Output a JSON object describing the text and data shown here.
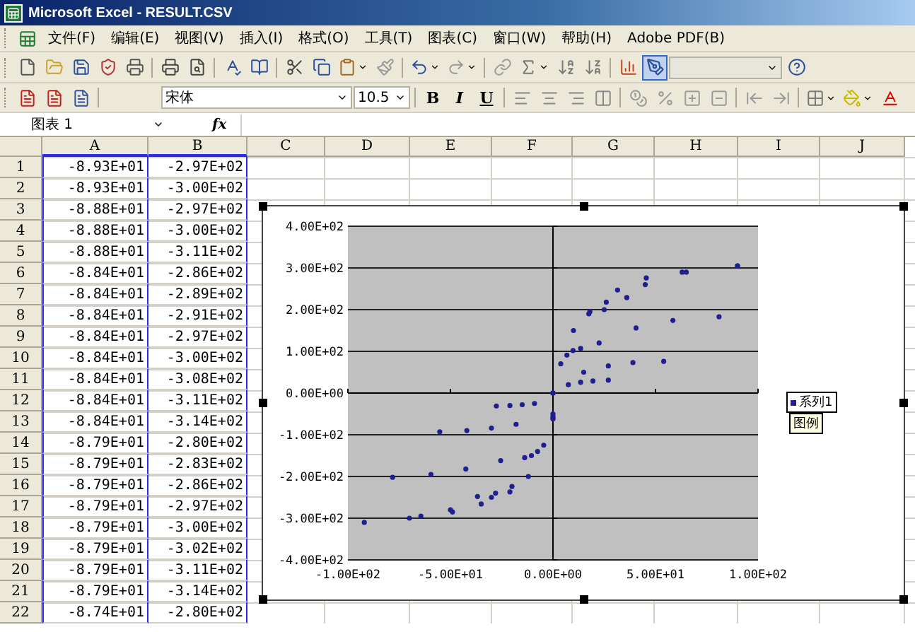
{
  "window": {
    "title": "Microsoft Excel - RESULT.CSV"
  },
  "menu": [
    {
      "label": "文件(F)"
    },
    {
      "label": "编辑(E)"
    },
    {
      "label": "视图(V)"
    },
    {
      "label": "插入(I)"
    },
    {
      "label": "格式(O)"
    },
    {
      "label": "工具(T)"
    },
    {
      "label": "图表(C)"
    },
    {
      "label": "窗口(W)"
    },
    {
      "label": "帮助(H)"
    },
    {
      "label": "Adobe PDF(B)"
    }
  ],
  "toolbar_standard": {
    "drawing_pressed": true
  },
  "toolbar_formatting": {
    "font": "宋体",
    "size": "10.5",
    "style_buttons": [
      "B",
      "I",
      "U"
    ]
  },
  "formula_bar": {
    "name_box": "图表 1",
    "fx": "fx"
  },
  "sheet": {
    "columns": [
      {
        "label": "A",
        "in_data_range": true
      },
      {
        "label": "B",
        "in_data_range": true
      },
      {
        "label": "C",
        "in_data_range": false
      },
      {
        "label": "D",
        "in_data_range": false
      },
      {
        "label": "E",
        "in_data_range": false
      },
      {
        "label": "F",
        "in_data_range": false
      },
      {
        "label": "G",
        "in_data_range": false
      },
      {
        "label": "H",
        "in_data_range": false
      },
      {
        "label": "I",
        "in_data_range": false
      },
      {
        "label": "J",
        "in_data_range": false
      }
    ],
    "rows": [
      {
        "number": "1",
        "cells": [
          "-8.93E+01",
          "-2.97E+02"
        ]
      },
      {
        "number": "2",
        "cells": [
          "-8.93E+01",
          "-3.00E+02"
        ]
      },
      {
        "number": "3",
        "cells": [
          "-8.88E+01",
          "-2.97E+02"
        ]
      },
      {
        "number": "4",
        "cells": [
          "-8.88E+01",
          "-3.00E+02"
        ]
      },
      {
        "number": "5",
        "cells": [
          "-8.88E+01",
          "-3.11E+02"
        ]
      },
      {
        "number": "6",
        "cells": [
          "-8.84E+01",
          "-2.86E+02"
        ]
      },
      {
        "number": "7",
        "cells": [
          "-8.84E+01",
          "-2.89E+02"
        ]
      },
      {
        "number": "8",
        "cells": [
          "-8.84E+01",
          "-2.91E+02"
        ]
      },
      {
        "number": "9",
        "cells": [
          "-8.84E+01",
          "-2.97E+02"
        ]
      },
      {
        "number": "10",
        "cells": [
          "-8.84E+01",
          "-3.00E+02"
        ]
      },
      {
        "number": "11",
        "cells": [
          "-8.84E+01",
          "-3.08E+02"
        ]
      },
      {
        "number": "12",
        "cells": [
          "-8.84E+01",
          "-3.11E+02"
        ]
      },
      {
        "number": "13",
        "cells": [
          "-8.84E+01",
          "-3.14E+02"
        ]
      },
      {
        "number": "14",
        "cells": [
          "-8.79E+01",
          "-2.80E+02"
        ]
      },
      {
        "number": "15",
        "cells": [
          "-8.79E+01",
          "-2.83E+02"
        ]
      },
      {
        "number": "16",
        "cells": [
          "-8.79E+01",
          "-2.86E+02"
        ]
      },
      {
        "number": "17",
        "cells": [
          "-8.79E+01",
          "-2.97E+02"
        ]
      },
      {
        "number": "18",
        "cells": [
          "-8.79E+01",
          "-3.00E+02"
        ]
      },
      {
        "number": "19",
        "cells": [
          "-8.79E+01",
          "-3.02E+02"
        ]
      },
      {
        "number": "20",
        "cells": [
          "-8.79E+01",
          "-3.11E+02"
        ]
      },
      {
        "number": "21",
        "cells": [
          "-8.79E+01",
          "-3.14E+02"
        ]
      },
      {
        "number": "22",
        "cells": [
          "-8.74E+01",
          "-2.80E+02"
        ]
      }
    ]
  },
  "chart": {
    "selected": true,
    "tooltip": "图例",
    "chart_data": {
      "type": "scatter",
      "grid": true,
      "xlim": [
        -100,
        100
      ],
      "ylim": [
        -400,
        400
      ],
      "xticks": [
        {
          "value": -100,
          "label": "-1.00E+02"
        },
        {
          "value": -50,
          "label": "-5.00E+01"
        },
        {
          "value": 0,
          "label": "0.00E+00"
        },
        {
          "value": 50,
          "label": "5.00E+01"
        },
        {
          "value": 100,
          "label": "1.00E+02"
        }
      ],
      "yticks": [
        {
          "value": 400,
          "label": "4.00E+02"
        },
        {
          "value": 300,
          "label": "3.00E+02"
        },
        {
          "value": 200,
          "label": "2.00E+02"
        },
        {
          "value": 100,
          "label": "1.00E+02"
        },
        {
          "value": 0,
          "label": "0.00E+00"
        },
        {
          "value": -100,
          "label": "-1.00E+02"
        },
        {
          "value": -200,
          "label": "-2.00E+02"
        },
        {
          "value": -300,
          "label": "-3.00E+02"
        },
        {
          "value": -400,
          "label": "-4.00E+02"
        }
      ],
      "x": [
        25,
        22.5,
        15,
        7.5,
        0,
        -9,
        -18,
        -25.5,
        -30,
        -21,
        -12,
        -4.5,
        0,
        3.8,
        10,
        17.5,
        45,
        40.5,
        27,
        13.5,
        0,
        -15,
        -30,
        -42.5,
        -50,
        -35,
        -20,
        -7.5,
        0,
        6.8,
        18,
        31.5,
        65,
        58.5,
        39,
        19.5,
        0,
        -21,
        -42,
        -59.5,
        -70,
        -49,
        -28,
        -10.5,
        0,
        9.8,
        26,
        45.5,
        90,
        81,
        54,
        27,
        0,
        -27.6,
        -55.2,
        -78.2,
        -92,
        -64.4,
        -36.8,
        -13.8,
        0,
        13.5,
        36,
        63,
        90
      ],
      "series": [
        {
          "name": "系列1",
          "color": "#1f1f8f",
          "values": [
            200,
            120,
            50,
            20,
            0,
            -25,
            -75,
            -162,
            -250,
            -237,
            -200,
            -125,
            -50,
            70,
            150,
            190,
            260,
            156,
            65,
            26,
            0,
            -28,
            -84,
            -182,
            -280,
            -266,
            -224,
            -140,
            -56,
            91,
            195,
            247,
            290,
            174,
            73,
            29,
            0,
            -30,
            -90,
            -195,
            -300,
            -285,
            -240,
            -150,
            -60,
            102,
            218,
            276,
            305,
            183,
            76,
            31,
            0,
            -31,
            -93,
            -202,
            -310,
            -295,
            -248,
            -155,
            -62,
            107,
            229,
            290,
            305
          ]
        }
      ]
    }
  }
}
